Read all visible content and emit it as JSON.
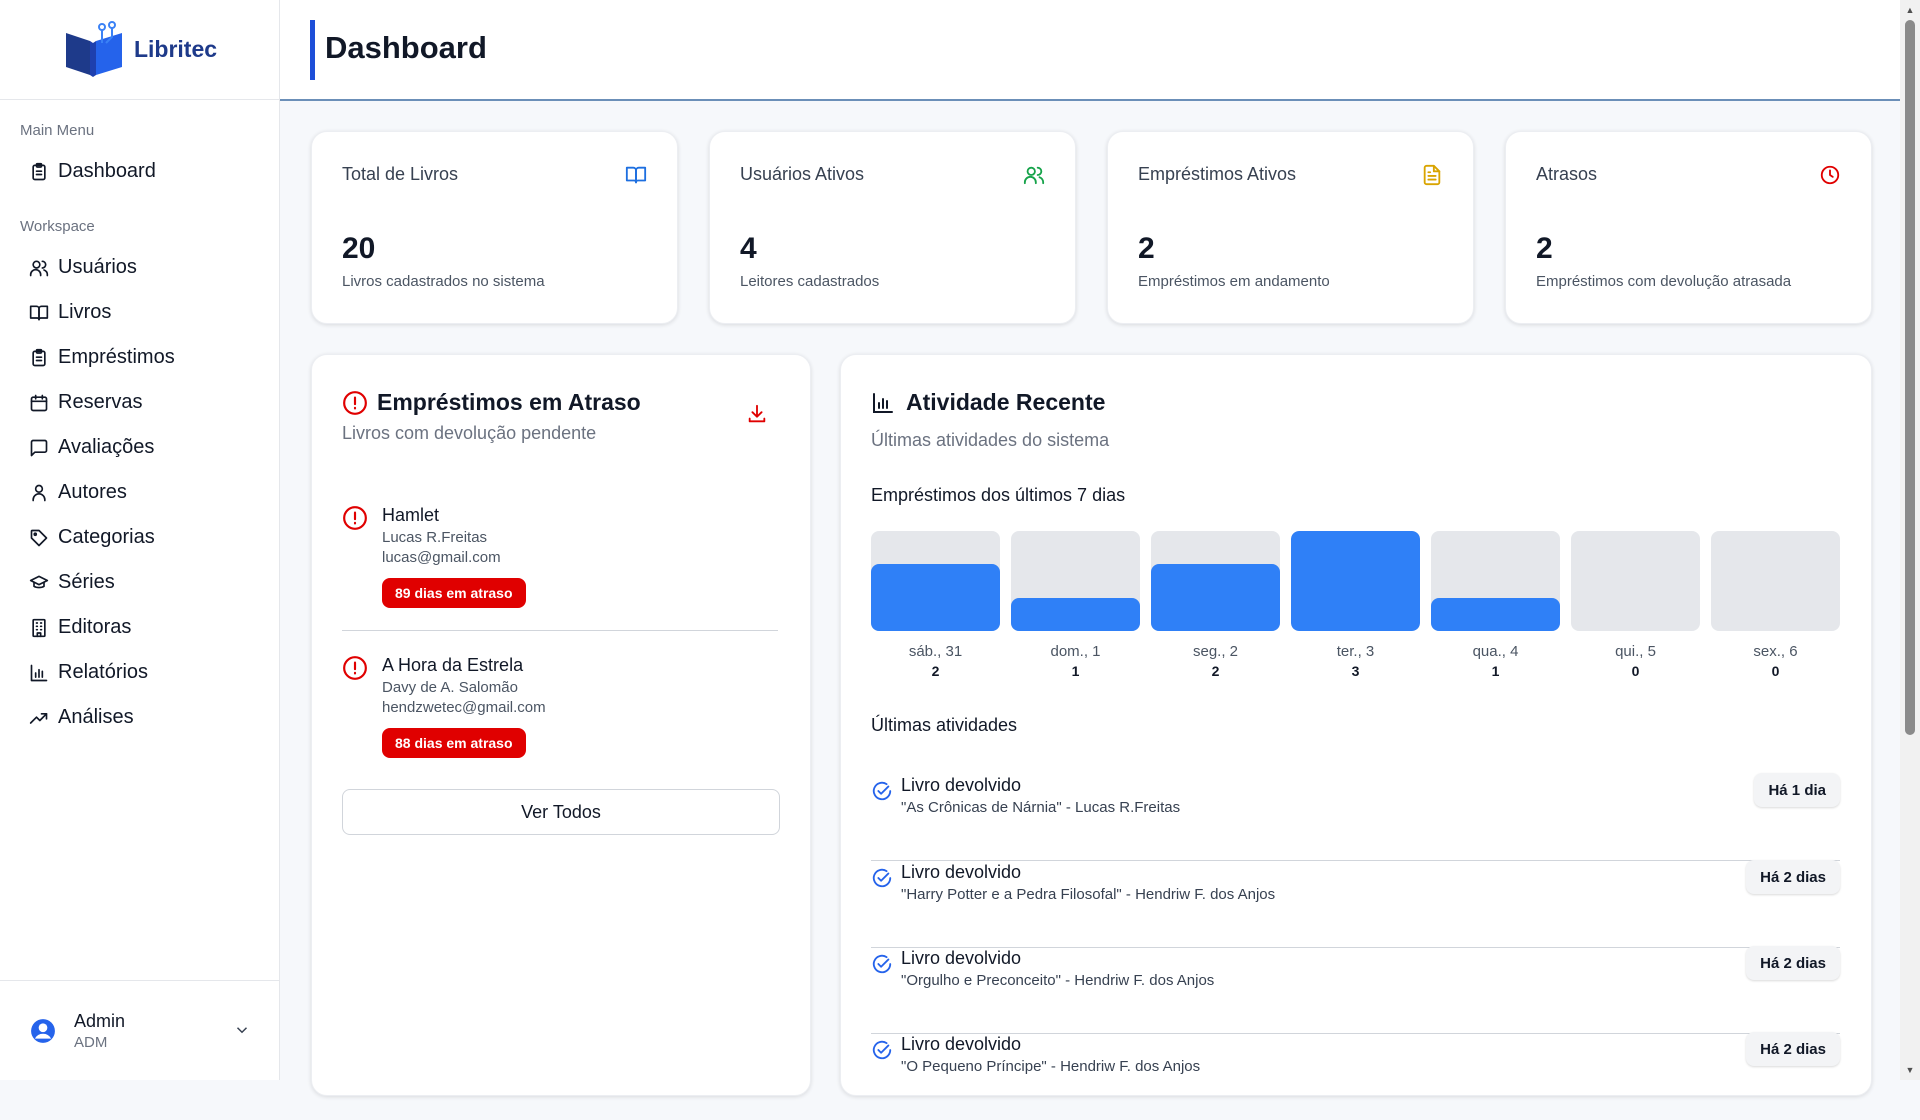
{
  "app": {
    "logo_text": "Libritec"
  },
  "header": {
    "title": "Dashboard"
  },
  "sidebar": {
    "main_menu_label": "Main Menu",
    "workspace_label": "Workspace",
    "main_items": [
      {
        "label": "Dashboard",
        "icon": "clipboard-icon"
      }
    ],
    "workspace_items": [
      {
        "label": "Usuários",
        "icon": "users-icon"
      },
      {
        "label": "Livros",
        "icon": "book-open-icon"
      },
      {
        "label": "Empréstimos",
        "icon": "clipboard-list-icon"
      },
      {
        "label": "Reservas",
        "icon": "calendar-icon"
      },
      {
        "label": "Avaliações",
        "icon": "message-square-icon"
      },
      {
        "label": "Autores",
        "icon": "user-icon"
      },
      {
        "label": "Categorias",
        "icon": "tag-icon"
      },
      {
        "label": "Séries",
        "icon": "graduation-cap-icon"
      },
      {
        "label": "Editoras",
        "icon": "building-icon"
      },
      {
        "label": "Relatórios",
        "icon": "bar-chart-icon"
      },
      {
        "label": "Análises",
        "icon": "trending-up-icon"
      }
    ],
    "user": {
      "name": "Admin",
      "role": "ADM"
    }
  },
  "stats": [
    {
      "title": "Total de Livros",
      "value": "20",
      "desc": "Livros cadastrados no sistema",
      "icon": "book-open-icon",
      "color": "#1d6fe0"
    },
    {
      "title": "Usuários Ativos",
      "value": "4",
      "desc": "Leitores cadastrados",
      "icon": "users-icon",
      "color": "#16a34a"
    },
    {
      "title": "Empréstimos Ativos",
      "value": "2",
      "desc": "Empréstimos em andamento",
      "icon": "file-text-icon",
      "color": "#d9a400"
    },
    {
      "title": "Atrasos",
      "value": "2",
      "desc": "Empréstimos com devolução atrasada",
      "icon": "clock-icon",
      "color": "#e00000"
    }
  ],
  "overdue": {
    "title": "Empréstimos em Atraso",
    "subtitle": "Livros com devolução pendente",
    "items": [
      {
        "book": "Hamlet",
        "user": "Lucas R.Freitas",
        "email": "lucas@gmail.com",
        "badge": "89 dias em atraso"
      },
      {
        "book": "A Hora da Estrela",
        "user": "Davy de A. Salomão",
        "email": "hendzwetec@gmail.com",
        "badge": "88 dias em atraso"
      }
    ],
    "view_all": "Ver Todos",
    "accent": "#e00000"
  },
  "activity": {
    "title": "Atividade Recente",
    "subtitle": "Últimas atividades do sistema",
    "chart_title": "Empréstimos dos últimos 7 dias",
    "recent_title": "Últimas atividades",
    "items": [
      {
        "title": "Livro devolvido",
        "desc": "\"As Crônicas de Nárnia\" - Lucas R.Freitas",
        "time": "Há 1 dia"
      },
      {
        "title": "Livro devolvido",
        "desc": "\"Harry Potter e a Pedra Filosofal\" - Hendriw F. dos Anjos",
        "time": "Há 2 dias"
      },
      {
        "title": "Livro devolvido",
        "desc": "\"Orgulho e Preconceito\" - Hendriw F. dos Anjos",
        "time": "Há 2 dias"
      },
      {
        "title": "Livro devolvido",
        "desc": "\"O Pequeno Príncipe\" - Hendriw F. dos Anjos",
        "time": "Há 2 dias"
      }
    ]
  },
  "chart_data": {
    "type": "bar",
    "title": "Empréstimos dos últimos 7 dias",
    "categories": [
      "sáb., 31",
      "dom., 1",
      "seg., 2",
      "ter., 3",
      "qua., 4",
      "qui., 5",
      "sex., 6"
    ],
    "values": [
      2,
      1,
      2,
      3,
      1,
      0,
      0
    ],
    "ylim": [
      0,
      3
    ],
    "bar_color": "#2f80f7",
    "track_color": "#e5e7eb"
  }
}
